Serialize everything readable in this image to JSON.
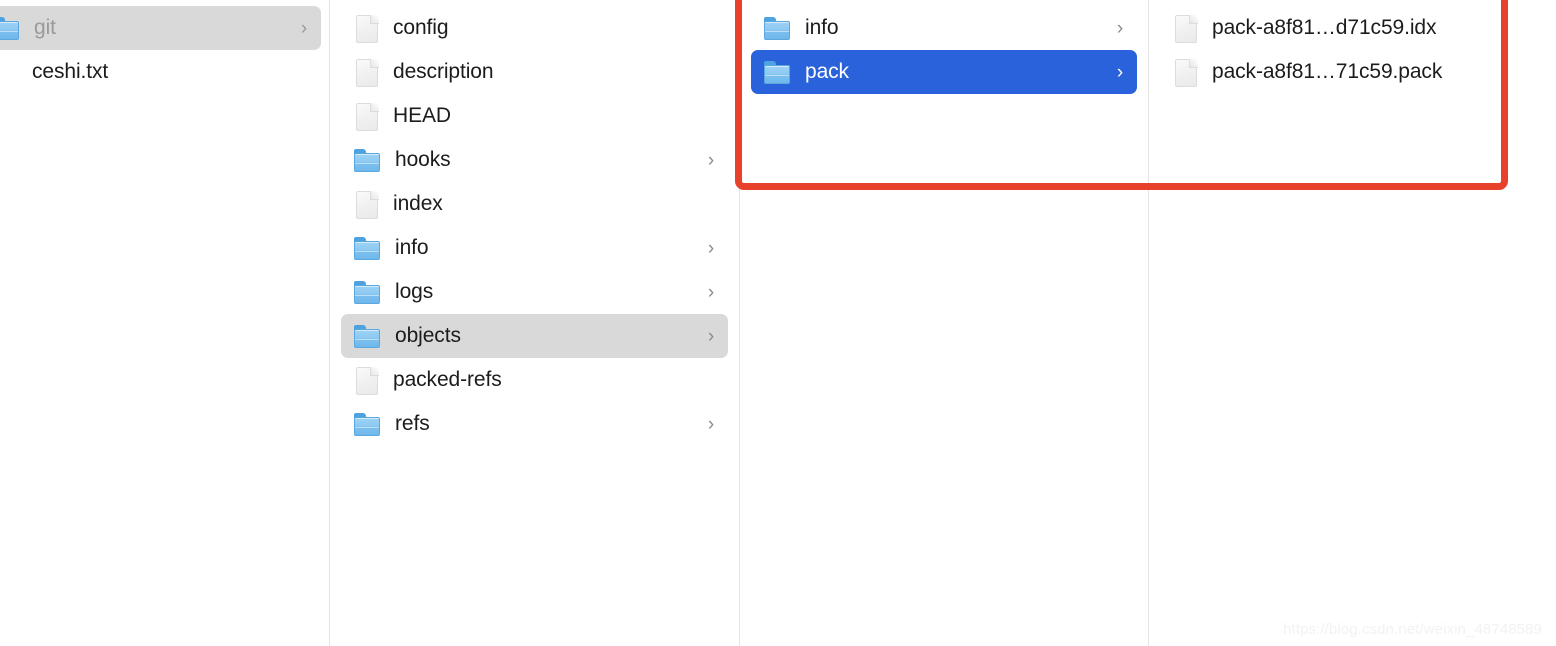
{
  "window": {
    "view_mode": "column-view",
    "background": "#ffffff",
    "divider_color": "#e3e3e3"
  },
  "colors": {
    "annotation_red": "#e8402a",
    "selection_blue": "#2a62db",
    "selection_gray": "#d9d9d9",
    "folder_blue": "#8cc9f2",
    "text_primary": "#1c1c1e",
    "text_dim": "#9a9a9a",
    "chevron_gray": "#8a8a8e"
  },
  "columns": [
    {
      "name": "column-1-repository-root",
      "items": [
        {
          "label": "git",
          "type": "folder",
          "has_chevron": true,
          "selection": "gray",
          "dimmed": true
        },
        {
          "label": "ceshi.txt",
          "type": "none",
          "has_chevron": false,
          "selection": "none",
          "dimmed": false
        }
      ]
    },
    {
      "name": "column-2-git-directory",
      "items": [
        {
          "label": "config",
          "type": "file",
          "has_chevron": false,
          "selection": "none",
          "dimmed": false
        },
        {
          "label": "description",
          "type": "file",
          "has_chevron": false,
          "selection": "none",
          "dimmed": false
        },
        {
          "label": "HEAD",
          "type": "file",
          "has_chevron": false,
          "selection": "none",
          "dimmed": false
        },
        {
          "label": "hooks",
          "type": "folder",
          "has_chevron": true,
          "selection": "none",
          "dimmed": false
        },
        {
          "label": "index",
          "type": "file",
          "has_chevron": false,
          "selection": "none",
          "dimmed": false
        },
        {
          "label": "info",
          "type": "folder",
          "has_chevron": true,
          "selection": "none",
          "dimmed": false
        },
        {
          "label": "logs",
          "type": "folder",
          "has_chevron": true,
          "selection": "none",
          "dimmed": false
        },
        {
          "label": "objects",
          "type": "folder",
          "has_chevron": true,
          "selection": "gray",
          "dimmed": false
        },
        {
          "label": "packed-refs",
          "type": "file",
          "has_chevron": false,
          "selection": "none",
          "dimmed": false
        },
        {
          "label": "refs",
          "type": "folder",
          "has_chevron": true,
          "selection": "none",
          "dimmed": false
        }
      ]
    },
    {
      "name": "column-3-objects-directory",
      "items": [
        {
          "label": "info",
          "type": "folder",
          "has_chevron": true,
          "selection": "none",
          "dimmed": false
        },
        {
          "label": "pack",
          "type": "folder",
          "has_chevron": true,
          "selection": "blue",
          "dimmed": false
        }
      ]
    },
    {
      "name": "column-4-pack-directory",
      "items": [
        {
          "label": "pack-a8f81…d71c59.idx",
          "type": "file",
          "has_chevron": false,
          "selection": "none",
          "dimmed": false
        },
        {
          "label": "pack-a8f81…71c59.pack",
          "type": "file",
          "has_chevron": false,
          "selection": "none",
          "dimmed": false
        }
      ]
    }
  ],
  "annotation": {
    "name": "red-highlight-box",
    "shape": "rectangle",
    "color": "#e8402a",
    "stroke_width_px": 7,
    "covers": "objects folder contents: info, pack, and the pack file listing"
  },
  "watermark": {
    "text": "https://blog.csdn.net/weixin_48748589"
  },
  "glyphs": {
    "chevron_right": "›"
  }
}
